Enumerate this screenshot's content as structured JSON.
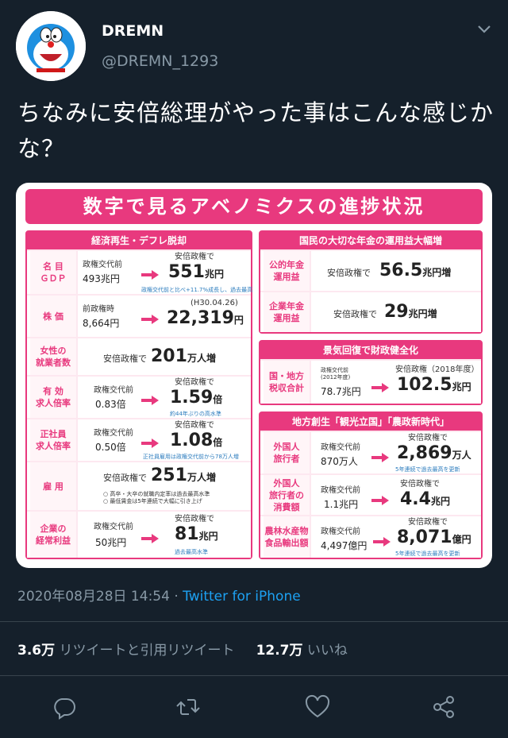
{
  "user": {
    "display_name": "DREMN",
    "handle": "@DREMN_1293",
    "avatar_icon": "doraemon-avatar-icon"
  },
  "tweet": {
    "text": "ちなみに安倍総理がやった事はこんな感じかな？"
  },
  "infographic": {
    "title": "数字で見るアベノミクスの進捗状況",
    "left_panel": {
      "header": "経済再生・デフレ脱却",
      "rows": [
        {
          "label": "名 目\nＧＤＰ",
          "before_caption": "政権交代前",
          "before_value": "493兆円",
          "after_caption": "安倍政権で",
          "after_value": "551",
          "after_unit": "兆円",
          "note": "政権交代前と比べ+11.7%成長し、過去最高"
        },
        {
          "label": "株 価",
          "before_caption": "前政権時",
          "before_value": "8,664円",
          "after_caption": "(H30.04.26)",
          "after_value": "22,319",
          "after_unit": "円",
          "note": ""
        },
        {
          "label": "女性の\n就業者数",
          "before_caption": "",
          "before_value": "",
          "after_caption": "安倍政権で",
          "after_value": "201",
          "after_unit": "万人増",
          "note": ""
        },
        {
          "label": "有 効\n求人倍率",
          "before_caption": "政権交代前",
          "before_value": "0.83倍",
          "after_caption": "安倍政権で",
          "after_value": "1.59",
          "after_unit": "倍",
          "note": "約44年ぶりの高水準"
        },
        {
          "label": "正社員\n求人倍率",
          "before_caption": "政権交代前",
          "before_value": "0.50倍",
          "after_caption": "安倍政権で",
          "after_value": "1.08",
          "after_unit": "倍",
          "note": "正社員雇用は政権交代前から78万人増"
        },
        {
          "label": "雇 用",
          "before_caption": "",
          "before_value": "",
          "after_caption": "安倍政権で",
          "after_value": "251",
          "after_unit": "万人増",
          "note": "○ 高卒・大卒の就職内定率は過去最高水準\n○ 最低賃金は5年連続で大幅に引き上げ"
        },
        {
          "label": "企業の\n経常利益",
          "before_caption": "政権交代前",
          "before_value": "50兆円",
          "after_caption": "安倍政権で",
          "after_value": "81",
          "after_unit": "兆円",
          "note": "過去最高水準"
        }
      ]
    },
    "right_panel_1": {
      "header": "国民の大切な年金の運用益大幅増",
      "rows": [
        {
          "label": "公的年金\n運用益",
          "after_caption": "安倍政権で",
          "after_value": "56.5",
          "after_unit": "兆円増"
        },
        {
          "label": "企業年金\n運用益",
          "after_caption": "安倍政権で",
          "after_value": "29",
          "after_unit": "兆円増"
        }
      ]
    },
    "right_panel_2": {
      "header": "景気回復で財政健全化",
      "rows": [
        {
          "label": "国・地方\n税収合計",
          "before_caption": "政権交代前\n(2012年度)",
          "before_value": "78.7兆円",
          "after_caption": "安倍政権（2018年度）",
          "after_value": "102.5",
          "after_unit": "兆円"
        }
      ]
    },
    "right_panel_3": {
      "header": "地方創生「観光立国」「農政新時代」",
      "rows": [
        {
          "label": "外国人\n旅行者",
          "before_caption": "政権交代前",
          "before_value": "870万人",
          "after_caption": "安倍政権で",
          "after_value": "2,869",
          "after_unit": "万人",
          "note": "5年連続で過去最高を更新"
        },
        {
          "label": "外国人\n旅行者の\n消費額",
          "before_caption": "政権交代前",
          "before_value": "1.1兆円",
          "after_caption": "安倍政権で",
          "after_value": "4.4",
          "after_unit": "兆円",
          "note": ""
        },
        {
          "label": "農林水産物\n食品輸出額",
          "before_caption": "政権交代前",
          "before_value": "4,497億円",
          "after_caption": "安倍政権で",
          "after_value": "8,071",
          "after_unit": "億円",
          "note": "5年連続で過去最高を更新"
        }
      ]
    }
  },
  "meta": {
    "timestamp": "2020年08月28日 14:54 · ",
    "source": "Twitter for iPhone"
  },
  "stats": {
    "retweets_count": "3.6万",
    "retweets_label": "リツイートと引用リツイート",
    "likes_count": "12.7万",
    "likes_label": "いいね"
  },
  "actions": {
    "reply_icon": "reply-icon",
    "retweet_icon": "retweet-icon",
    "like_icon": "heart-icon",
    "share_icon": "share-icon"
  },
  "colors": {
    "background": "#15202b",
    "accent": "#e8397e",
    "link": "#1da1f2",
    "muted": "#8899a6"
  }
}
